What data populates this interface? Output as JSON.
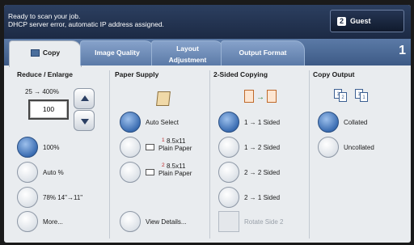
{
  "status": {
    "line1": "Ready to scan your job.",
    "line2": "DHCP server error, automatic IP address assigned.",
    "guest_label": "Guest",
    "guest_icon": "user-icon"
  },
  "tabs": [
    {
      "label": "Copy",
      "active": true
    },
    {
      "label": "Image Quality",
      "active": false
    },
    {
      "label_line1": "Layout",
      "label_line2": "Adjustment",
      "active": false
    },
    {
      "label": "Output Format",
      "active": false
    }
  ],
  "page_number": "1",
  "reduce_enlarge": {
    "title": "Reduce / Enlarge",
    "range": "25 → 400%",
    "value": "100",
    "options": [
      "100%",
      "Auto %",
      "78% 14\"→11\"",
      "More..."
    ],
    "selected": "100%"
  },
  "paper_supply": {
    "title": "Paper Supply",
    "options": [
      {
        "label": "Auto Select"
      },
      {
        "tray": "1",
        "label_line1": "8.5x11",
        "label_line2": "Plain Paper"
      },
      {
        "tray": "2",
        "label_line1": "8.5x11",
        "label_line2": "Plain Paper"
      },
      {
        "label": "View Details..."
      }
    ],
    "selected": "Auto Select"
  },
  "two_sided": {
    "title": "2-Sided Copying",
    "options": [
      "1 → 1 Sided",
      "1 → 2 Sided",
      "2 → 2 Sided",
      "2 → 1 Sided"
    ],
    "selected": "1 → 1 Sided",
    "rotate_label": "Rotate Side 2"
  },
  "copy_output": {
    "title": "Copy Output",
    "options": [
      "Collated",
      "Uncollated"
    ],
    "selected": "Collated"
  },
  "colors": {
    "accent": "#3b6db2",
    "tab_bar": "#4a6891",
    "status_bar": "#23334f"
  }
}
